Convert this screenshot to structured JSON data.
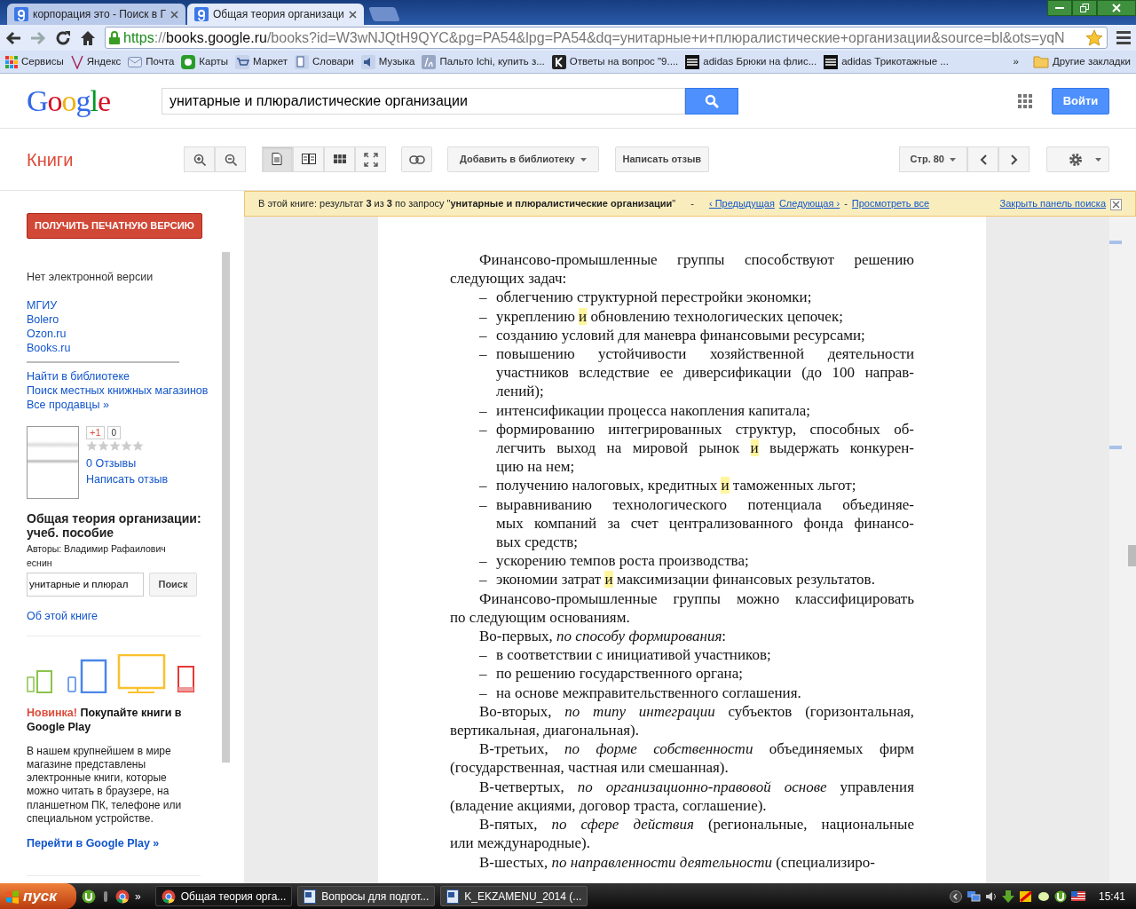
{
  "browser": {
    "tabs": [
      {
        "title": "корпорация это - Поиск в Г",
        "selected": false
      },
      {
        "title": "Общая теория организаци",
        "selected": true
      }
    ],
    "address": {
      "scheme": "https",
      "separator": "://",
      "domain": "books.google.ru",
      "path": "/books?id=W3wNJQtH9QYC&pg=PA54&lpg=PA54&dq=унитарные+и+плюралистические+организации&source=bl&ots=yqN"
    },
    "bookmarks": [
      {
        "label": "Сервисы",
        "kind": "apps"
      },
      {
        "label": "Яндекс",
        "kind": "yandex"
      },
      {
        "label": "Почта",
        "kind": "mail"
      },
      {
        "label": "Карты",
        "kind": "maps"
      },
      {
        "label": "Маркет",
        "kind": "cart"
      },
      {
        "label": "Словари",
        "kind": "dict"
      },
      {
        "label": "Музыка",
        "kind": "speaker"
      },
      {
        "label": "Пальто Ichi, купить з...",
        "kind": "la"
      },
      {
        "label": "Ответы на вопрос \"9....",
        "kind": "k"
      },
      {
        "label": "adidas Брюки на флис...",
        "kind": "stripes"
      },
      {
        "label": "adidas Трикотажные ...",
        "kind": "stripes"
      }
    ],
    "bookmarks_more": "»",
    "other_bookmarks": "Другие закладки"
  },
  "header": {
    "logo": "Google",
    "search_value": "унитарные и плюралистические организации",
    "signin": "Войти"
  },
  "toolbar": {
    "title": "Книги",
    "views": [
      {
        "kind": "single",
        "selected": true
      },
      {
        "kind": "double",
        "selected": false
      },
      {
        "kind": "grid",
        "selected": false
      },
      {
        "kind": "fullscreen",
        "selected": false
      }
    ],
    "add_to_library": "Добавить в библиотеку",
    "write_review": "Написать отзыв",
    "page": "Стр. 80"
  },
  "search_bar": {
    "text": "В этой книге: результат **3** из **3** по запросу \"**унитарные и плюралистические организации**\"",
    "sep1": "-",
    "prev": "‹ Предыдущая",
    "next": "Следующая ›",
    "sep2": "-",
    "view_all": "Просмотреть все",
    "close": "Закрыть панель поиска"
  },
  "sidebar": {
    "buy": "ПОЛУЧИТЬ ПЕЧАТНУЮ ВЕРСИЮ",
    "no_ebook": "Нет электронной версии",
    "sellers": [
      "МГИУ",
      "Bolero",
      "Ozon.ru",
      "Books.ru"
    ],
    "links": [
      "Найти в библиотеке",
      "Поиск местных книжных магазинов",
      "Все продавцы »"
    ],
    "plus_one": "+1",
    "plus_count": "0",
    "stars": 0,
    "reviews": "0 Отзывы",
    "write_review": "Написать отзыв",
    "book_title": "Общая теория организации: учеб. пособие",
    "authors": "Авторы: Владимир Рафаилович",
    "author_cut": "еснин",
    "search_value": "унитарные и плюрал",
    "search_button": "Поиск",
    "about": "Об этой книге",
    "promo_badge": "Новинка!",
    "promo_title": "Покупайте книги в Google Play",
    "promo_text": "В нашем крупнейшем в мире магазине представлены электронные книги, которые можно читать в браузере, на планшетном ПК, телефоне или специальном устройстве.",
    "promo_link": "Перейти в Google Play »"
  },
  "book_page": [
    {
      "kind": "para",
      "lines": [
        "Финансово-промышленные группы способствуют решению",
        "следующих задач:"
      ]
    },
    {
      "kind": "dash",
      "marker": "–",
      "lines": [
        "облегчению структурной перестройки экономки;"
      ]
    },
    {
      "kind": "dash",
      "marker": "–",
      "lines": [
        [
          {
            "text": "укреплению ",
            "highlight": false
          },
          {
            "text": "и",
            "highlight": true
          },
          {
            "text": " обновлению технологических цепочек;",
            "highlight": false
          }
        ]
      ]
    },
    {
      "kind": "dash",
      "marker": "–",
      "lines": [
        "созданию условий для маневра финансовыми ресурсами;"
      ]
    },
    {
      "kind": "dash",
      "marker": "–",
      "lines": [
        "повышению устойчивости хозяйственной деятельности",
        "участников вследствие ее диверсификации (до 100 направ-",
        "лений);"
      ]
    },
    {
      "kind": "dash",
      "marker": "–",
      "lines": [
        "интенсификации процесса накопления капитала;"
      ]
    },
    {
      "kind": "dash",
      "marker": "–",
      "lines": [
        "формированию интегрированных структур, способных об-",
        [
          {
            "text": "легчить выход на мировой рынок ",
            "highlight": false
          },
          {
            "text": "и",
            "highlight": true
          },
          {
            "text": " выдержать конкурен-",
            "highlight": false
          }
        ],
        "цию на нем;"
      ]
    },
    {
      "kind": "dash",
      "marker": "–",
      "lines": [
        [
          {
            "text": "получению налоговых, кредитных ",
            "highlight": false
          },
          {
            "text": "и",
            "highlight": true
          },
          {
            "text": " таможенных льгот;",
            "highlight": false
          }
        ]
      ]
    },
    {
      "kind": "dash",
      "marker": "–",
      "lines": [
        "выравниванию технологического потенциала объединяе-",
        "мых компаний за счет централизованного фонда финансо-",
        "вых средств;"
      ]
    },
    {
      "kind": "dash",
      "marker": "–",
      "lines": [
        "ускорению темпов роста производства;"
      ]
    },
    {
      "kind": "dash",
      "marker": "–",
      "lines": [
        [
          {
            "text": "экономии затрат ",
            "highlight": false
          },
          {
            "text": "и",
            "highlight": true
          },
          {
            "text": " максимизации финансовых результатов.",
            "highlight": false
          }
        ]
      ]
    },
    {
      "kind": "para",
      "lines": [
        "Финансово-промышленные группы можно классифицировать",
        "по следующим основаниям."
      ]
    },
    {
      "kind": "para",
      "lines": [
        "Во-первых, *по способу формирования*:"
      ]
    },
    {
      "kind": "dash",
      "marker": "–",
      "lines": [
        "в соответствии с инициативой участников;"
      ]
    },
    {
      "kind": "dash",
      "marker": "–",
      "lines": [
        "по решению государственного органа;"
      ]
    },
    {
      "kind": "dash",
      "marker": "–",
      "lines": [
        "на основе межправительственного соглашения."
      ]
    },
    {
      "kind": "para",
      "lines": [
        "Во-вторых, *по типу интеграции* субъектов (горизонтальная,",
        "вертикальная, диагональная)."
      ]
    },
    {
      "kind": "para",
      "lines": [
        "В-третьих, *по форме собственности* объединяемых фирм",
        "(государственная, частная или смешанная)."
      ]
    },
    {
      "kind": "para",
      "lines": [
        "В-четвертых, *по организационно-правовой основе* управления",
        "(владение акциями, договор траста, соглашение)."
      ]
    },
    {
      "kind": "para",
      "lines": [
        "В-пятых, *по сфере действия* (региональные, национальные",
        "или международные)."
      ]
    },
    {
      "kind": "para",
      "lines": [
        "В-шестых, *по направленности деятельности* (специализиро-"
      ]
    }
  ],
  "taskbar": {
    "start": "пуск",
    "more": "»",
    "tasks": [
      {
        "label": "Общая теория орга...",
        "kind": "chrome",
        "selected": true
      },
      {
        "label": "Вопросы для подгот...",
        "kind": "word",
        "selected": false
      },
      {
        "label": "K_EKZAMENU_2014 (...",
        "kind": "word",
        "selected": false
      }
    ],
    "clock": "15:41"
  }
}
